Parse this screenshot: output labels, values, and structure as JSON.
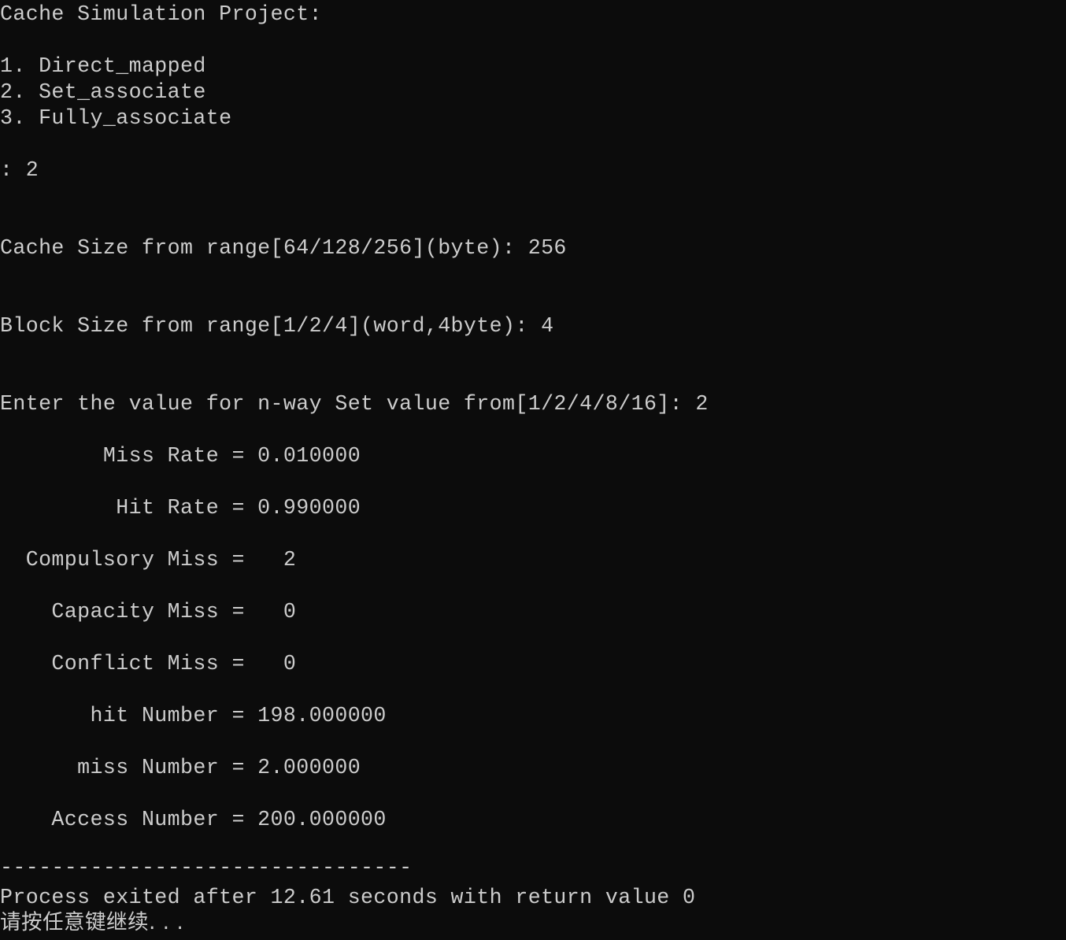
{
  "console": {
    "header": "Cache Simulation Project:",
    "menu": [
      "1. Direct_mapped",
      "2. Set_associate",
      "3. Fully_associate"
    ],
    "choice_prompt": ": 2",
    "cache_size_prompt": "Cache Size from range[64/128/256](byte): 256",
    "block_size_prompt": "Block Size from range[1/2/4](word,4byte): 4",
    "nway_prompt": "Enter the value for n-way Set value from[1/2/4/8/16]: 2",
    "results": [
      "        Miss Rate = 0.010000",
      "         Hit Rate = 0.990000",
      "  Compulsory Miss =   2",
      "    Capacity Miss =   0",
      "    Conflict Miss =   0",
      "       hit Number = 198.000000",
      "      miss Number = 2.000000",
      "    Access Number = 200.000000"
    ],
    "separator": "--------------------------------",
    "process_exit": "Process exited after 12.61 seconds with return value 0",
    "continue_prompt": "请按任意键继续. . ."
  }
}
